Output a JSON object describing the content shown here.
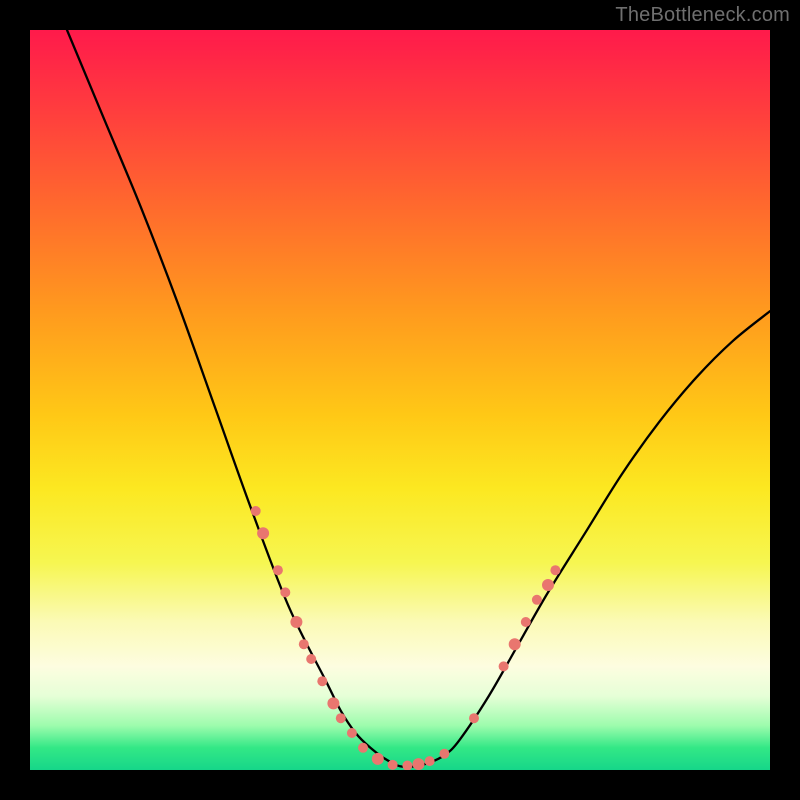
{
  "watermark": "TheBottleneck.com",
  "colors": {
    "frame": "#000000",
    "curve": "#000000",
    "marker": "#e9766f",
    "gradient_top": "#ff1a4b",
    "gradient_bottom": "#16d689"
  },
  "chart_data": {
    "type": "line",
    "title": "",
    "xlabel": "",
    "ylabel": "",
    "xlim": [
      0,
      100
    ],
    "ylim": [
      0,
      100
    ],
    "series": [
      {
        "name": "bottleneck-curve",
        "x": [
          5,
          10,
          15,
          20,
          25,
          30,
          35,
          40,
          42,
          44,
          46,
          48,
          50,
          52,
          54,
          56,
          58,
          62,
          66,
          70,
          75,
          80,
          85,
          90,
          95,
          100
        ],
        "y": [
          100,
          88,
          76,
          63,
          49,
          35,
          22,
          12,
          8,
          5,
          3,
          1.5,
          0.5,
          0.5,
          1,
          2,
          4,
          10,
          17,
          24,
          32,
          40,
          47,
          53,
          58,
          62
        ]
      }
    ],
    "markers": [
      {
        "x": 30.5,
        "y": 35,
        "r": 5
      },
      {
        "x": 31.5,
        "y": 32,
        "r": 6
      },
      {
        "x": 33.5,
        "y": 27,
        "r": 5
      },
      {
        "x": 34.5,
        "y": 24,
        "r": 5
      },
      {
        "x": 36.0,
        "y": 20,
        "r": 6
      },
      {
        "x": 37.0,
        "y": 17,
        "r": 5
      },
      {
        "x": 38.0,
        "y": 15,
        "r": 5
      },
      {
        "x": 39.5,
        "y": 12,
        "r": 5
      },
      {
        "x": 41.0,
        "y": 9,
        "r": 6
      },
      {
        "x": 42.0,
        "y": 7,
        "r": 5
      },
      {
        "x": 43.5,
        "y": 5,
        "r": 5
      },
      {
        "x": 45.0,
        "y": 3,
        "r": 5
      },
      {
        "x": 47.0,
        "y": 1.5,
        "r": 6
      },
      {
        "x": 49.0,
        "y": 0.7,
        "r": 5
      },
      {
        "x": 51.0,
        "y": 0.6,
        "r": 5
      },
      {
        "x": 52.5,
        "y": 0.8,
        "r": 6
      },
      {
        "x": 54.0,
        "y": 1.2,
        "r": 5
      },
      {
        "x": 56.0,
        "y": 2.2,
        "r": 5
      },
      {
        "x": 60.0,
        "y": 7,
        "r": 5
      },
      {
        "x": 64.0,
        "y": 14,
        "r": 5
      },
      {
        "x": 65.5,
        "y": 17,
        "r": 6
      },
      {
        "x": 67.0,
        "y": 20,
        "r": 5
      },
      {
        "x": 68.5,
        "y": 23,
        "r": 5
      },
      {
        "x": 70.0,
        "y": 25,
        "r": 6
      },
      {
        "x": 71.0,
        "y": 27,
        "r": 5
      }
    ]
  }
}
